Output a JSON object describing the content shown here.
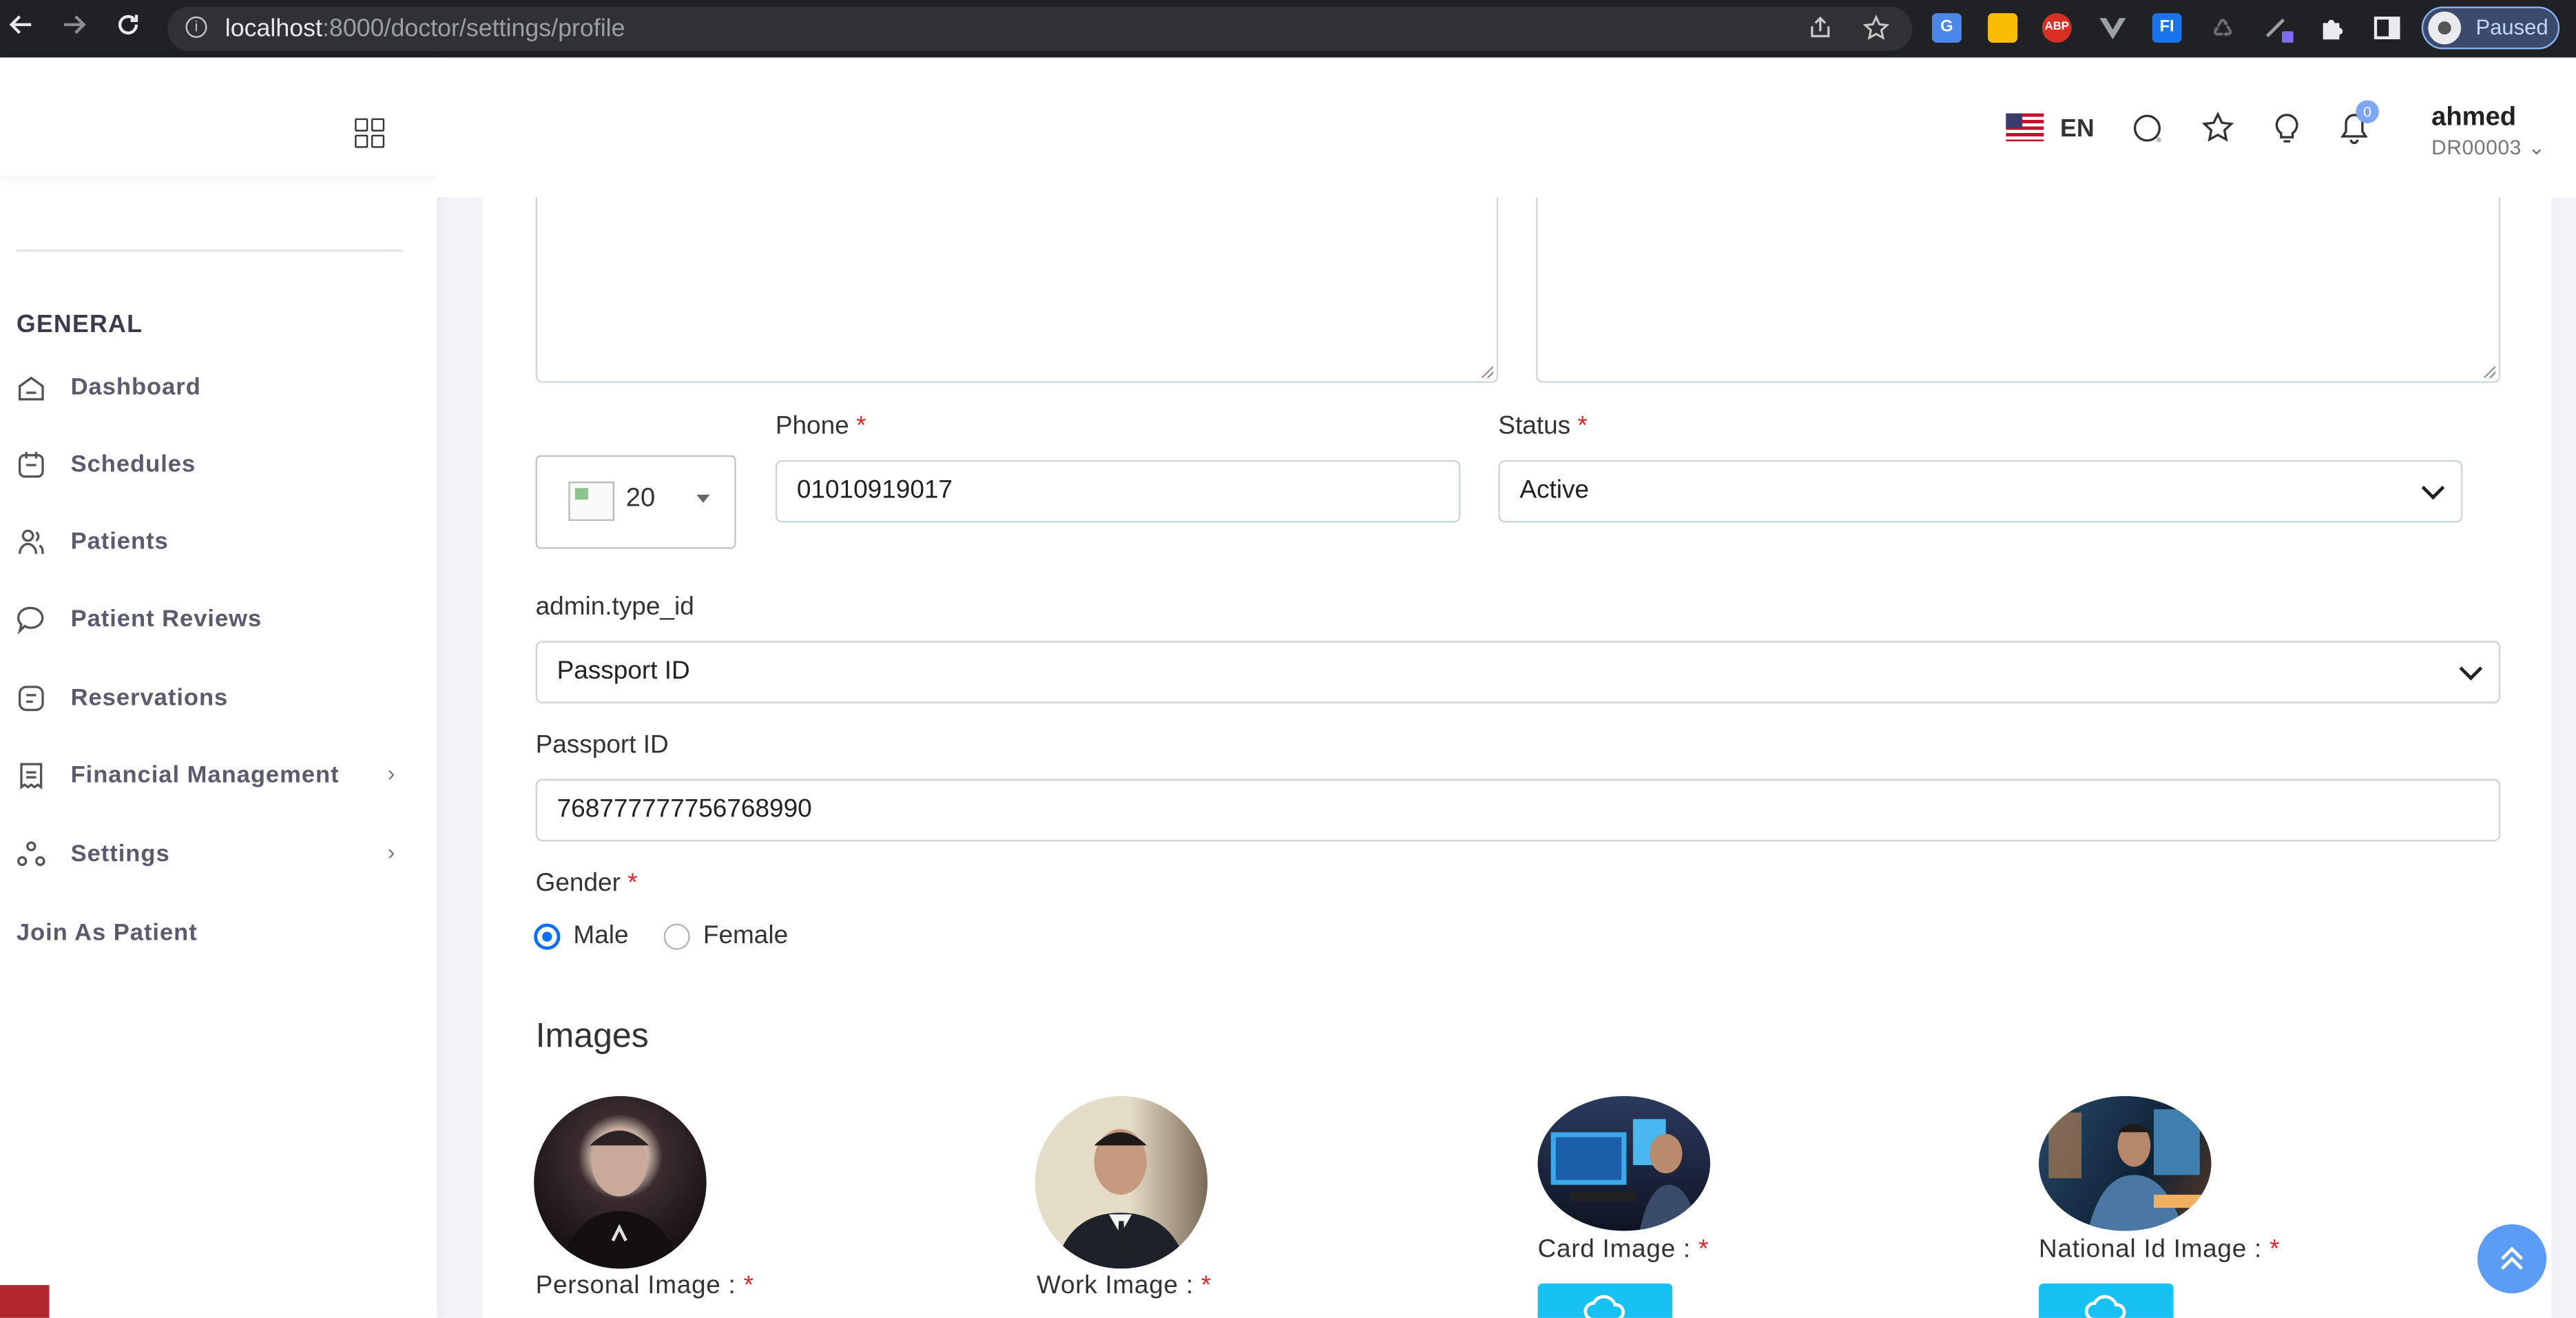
{
  "browser": {
    "url_host": "localhost",
    "url_path": ":8000/doctor/settings/profile",
    "profile_status": "Paused",
    "extensions": [
      "google-translate-icon",
      "keep-icon",
      "adblock-icon",
      "vue-devtools-icon",
      "fi-extension-icon",
      "recycle-extension-icon",
      "pen-extension-icon",
      "puzzle-icon",
      "sidepanel-icon"
    ],
    "ext_abp_text": "ABP",
    "ext_fi_text": "FI"
  },
  "sidebar": {
    "section_title": "GENERAL",
    "items": [
      {
        "label": "Dashboard",
        "icon": "home-icon"
      },
      {
        "label": "Schedules",
        "icon": "calendar-icon"
      },
      {
        "label": "Patients",
        "icon": "users-icon"
      },
      {
        "label": "Patient Reviews",
        "icon": "chat-icon"
      },
      {
        "label": "Reservations",
        "icon": "reservation-icon"
      },
      {
        "label": "Financial Management",
        "icon": "finance-icon",
        "has_submenu": true
      },
      {
        "label": "Settings",
        "icon": "settings-icon",
        "has_submenu": true
      }
    ],
    "join_link": "Join As Patient",
    "chevron": "›"
  },
  "header": {
    "language": "EN",
    "notification_count": "0",
    "user_name": "ahmed",
    "user_code": "DR00003"
  },
  "form": {
    "phone_label": "Phone",
    "phone_value": "01010919017",
    "country_code": "20",
    "status_label": "Status",
    "status_value": "Active",
    "type_label": "admin.type_id",
    "type_value": "Passport ID",
    "passport_label": "Passport ID",
    "passport_value": "768777777756768990",
    "gender_label": "Gender",
    "gender_options": [
      "Male",
      "Female"
    ],
    "gender_selected": "Male",
    "required_mark": "*"
  },
  "images": {
    "title": "Images",
    "personal_label": "Personal Image :",
    "work_label": "Work Image :",
    "card_label": "Card Image :",
    "national_label": "National Id Image :"
  },
  "colors": {
    "accent": "#0d6efd",
    "upload_button": "#17c1f1",
    "scroll_top": "#5b9cf6",
    "required": "#e3242b"
  }
}
